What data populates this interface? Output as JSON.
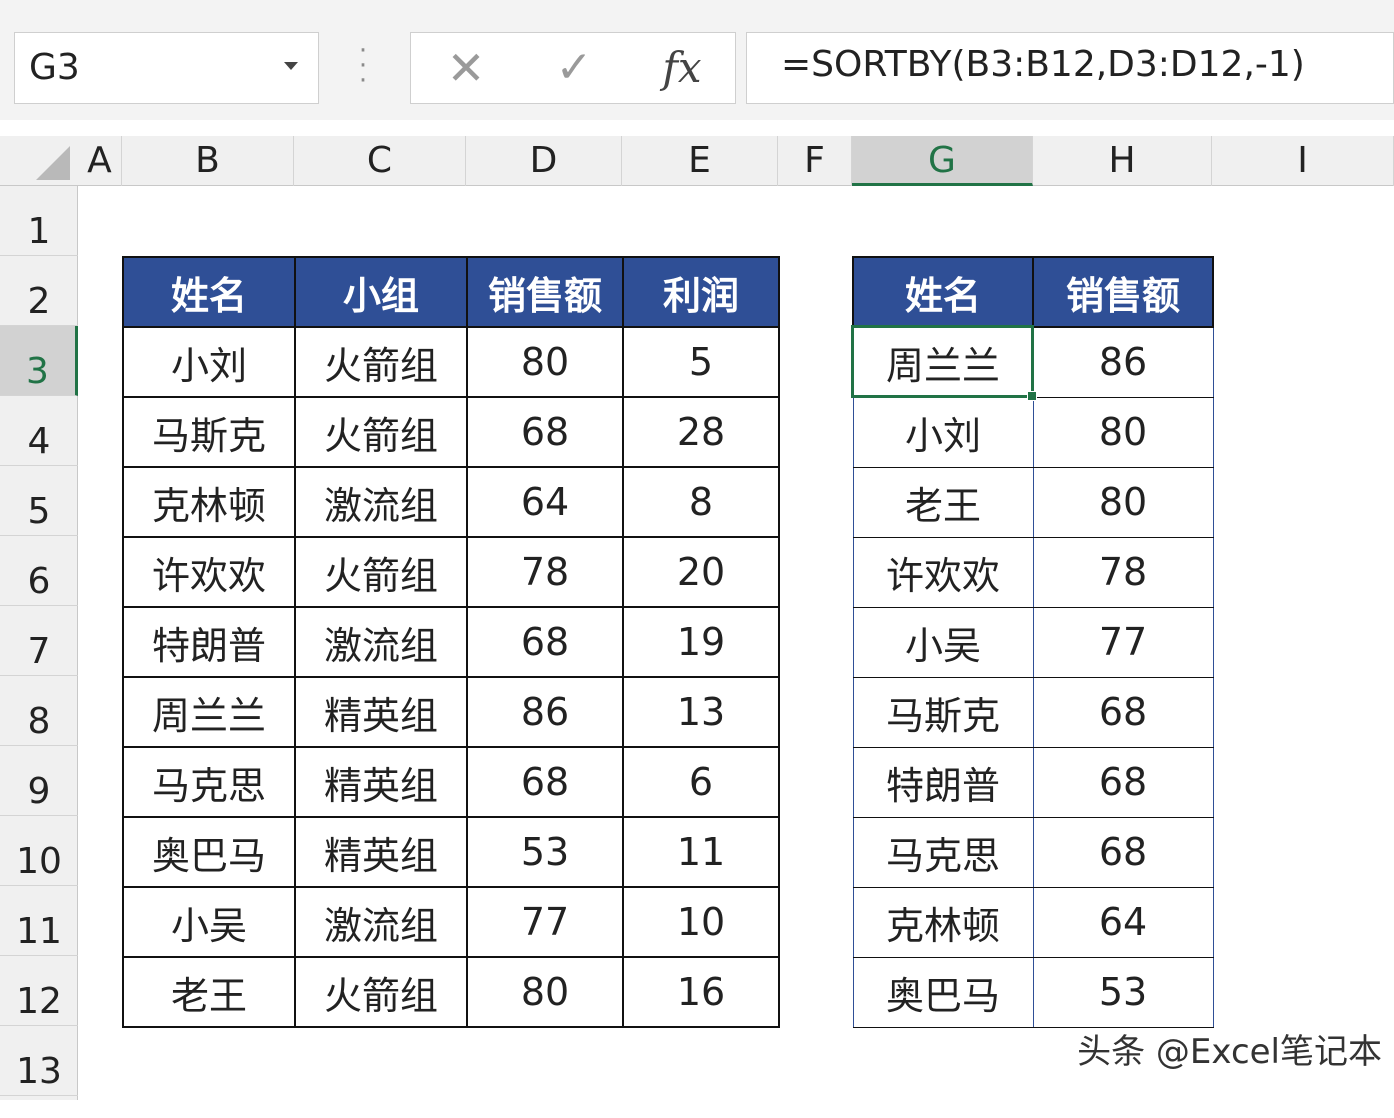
{
  "formula_bar": {
    "name_box": "G3",
    "formula": "=SORTBY(B3:B12,D3:D12,-1)",
    "icons": {
      "cancel": "cancel-icon",
      "enter": "enter-icon",
      "function": "fx-icon"
    },
    "fx_label": "fx"
  },
  "columns": [
    "A",
    "B",
    "C",
    "D",
    "E",
    "F",
    "G",
    "H",
    "I"
  ],
  "rows": [
    "1",
    "2",
    "3",
    "4",
    "5",
    "6",
    "7",
    "8",
    "9",
    "10",
    "11",
    "12",
    "13"
  ],
  "selected_cell": {
    "column": "G",
    "row": "3"
  },
  "source_table": {
    "headers": [
      "姓名",
      "小组",
      "销售额",
      "利润"
    ],
    "rows": [
      [
        "小刘",
        "火箭组",
        "80",
        "5"
      ],
      [
        "马斯克",
        "火箭组",
        "68",
        "28"
      ],
      [
        "克林顿",
        "激流组",
        "64",
        "8"
      ],
      [
        "许欢欢",
        "火箭组",
        "78",
        "20"
      ],
      [
        "特朗普",
        "激流组",
        "68",
        "19"
      ],
      [
        "周兰兰",
        "精英组",
        "86",
        "13"
      ],
      [
        "马克思",
        "精英组",
        "68",
        "6"
      ],
      [
        "奥巴马",
        "精英组",
        "53",
        "11"
      ],
      [
        "小吴",
        "激流组",
        "77",
        "10"
      ],
      [
        "老王",
        "火箭组",
        "80",
        "16"
      ]
    ]
  },
  "sorted_table": {
    "headers": [
      "姓名",
      "销售额"
    ],
    "rows": [
      [
        "周兰兰",
        "86"
      ],
      [
        "小刘",
        "80"
      ],
      [
        "老王",
        "80"
      ],
      [
        "许欢欢",
        "78"
      ],
      [
        "小吴",
        "77"
      ],
      [
        "马斯克",
        "68"
      ],
      [
        "特朗普",
        "68"
      ],
      [
        "马克思",
        "68"
      ],
      [
        "克林顿",
        "64"
      ],
      [
        "奥巴马",
        "53"
      ]
    ]
  },
  "watermark": "头条 @Excel笔记本",
  "colors": {
    "header_fill": "#2f4f96",
    "selection": "#217346"
  }
}
